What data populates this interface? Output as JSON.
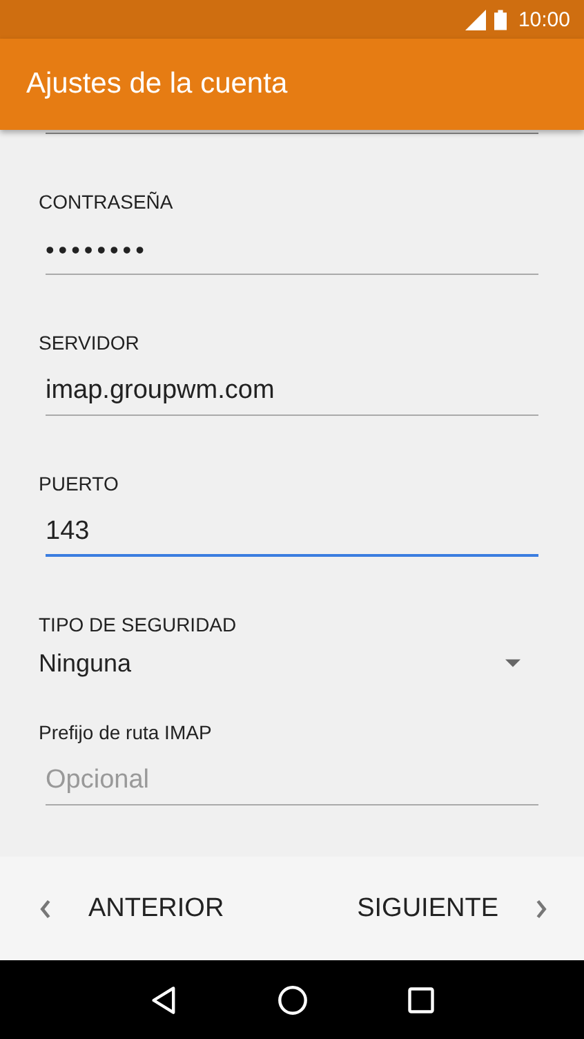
{
  "status_bar": {
    "time": "10:00"
  },
  "app_bar": {
    "title": "Ajustes de la cuenta"
  },
  "fields": [
    {
      "kind": "password",
      "label": "CONTRASEÑA",
      "value": "••••••••",
      "focused": false
    },
    {
      "kind": "text",
      "label": "SERVIDOR",
      "value": "imap.groupwm.com",
      "focused": false
    },
    {
      "kind": "text",
      "label": "PUERTO",
      "value": "143",
      "focused": true
    },
    {
      "kind": "dropdown",
      "label": "TIPO DE SEGURIDAD",
      "value": "Ninguna"
    },
    {
      "kind": "text",
      "label": "Prefijo de ruta IMAP",
      "placeholder": "Opcional",
      "focused": false
    }
  ],
  "footer": {
    "back": "ANTERIOR",
    "next": "SIGUIENTE"
  }
}
